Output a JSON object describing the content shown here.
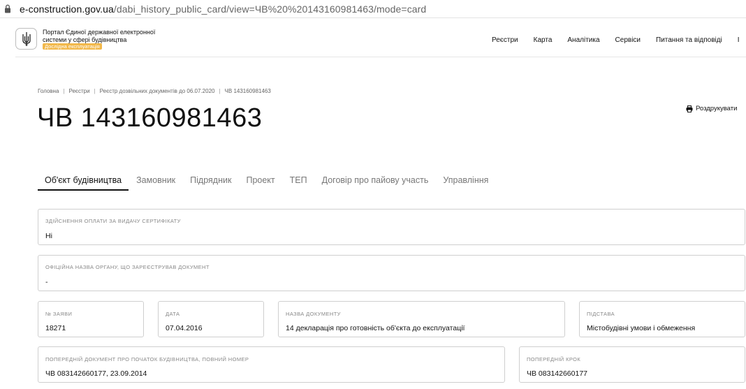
{
  "browser": {
    "url_host": "e-construction.gov.ua",
    "url_path": "/dabi_history_public_card/view=ЧВ%20%20143160981463/mode=card"
  },
  "header": {
    "logo_text": "Портал Єдиної державної електронної системи у сфері будівництва",
    "logo_badge": "Дослідна експлуатація",
    "nav": [
      "Реєстри",
      "Карта",
      "Аналітика",
      "Сервіси",
      "Питання та відповіді",
      "І"
    ]
  },
  "breadcrumb": {
    "items": [
      "Головна",
      "Реєстри",
      "Реєстр дозвільних документів до 06.07.2020"
    ],
    "current": "ЧВ 143160981463"
  },
  "page_title": "ЧВ 143160981463",
  "print_label": "Роздрукувати",
  "tabs": [
    "Об'єкт будівництва",
    "Замовник",
    "Підрядник",
    "Проект",
    "ТЕП",
    "Договір про пайову участь",
    "Управління"
  ],
  "fields": {
    "payment": {
      "label": "Здійснення оплати за видачу сертифікату",
      "value": "Ні"
    },
    "authority": {
      "label": "Офіційна назва органу, що зареєстрував документ",
      "value": "-"
    },
    "application_no": {
      "label": "№ заяви",
      "value": "18271"
    },
    "date": {
      "label": "Дата",
      "value": "07.04.2016"
    },
    "doc_name": {
      "label": "Назва документу",
      "value": "14 декларація про готовність об'єкта до експлуатації"
    },
    "basis": {
      "label": "Підстава",
      "value": "Містобудівні умови і обмеження"
    },
    "prev_doc": {
      "label": "Попередній документ про початок будівництва, повний номер",
      "value": "ЧВ 083142660177, 23.09.2014"
    },
    "prev_step": {
      "label": "Попередній крок",
      "value": "ЧВ 083142660177"
    }
  }
}
